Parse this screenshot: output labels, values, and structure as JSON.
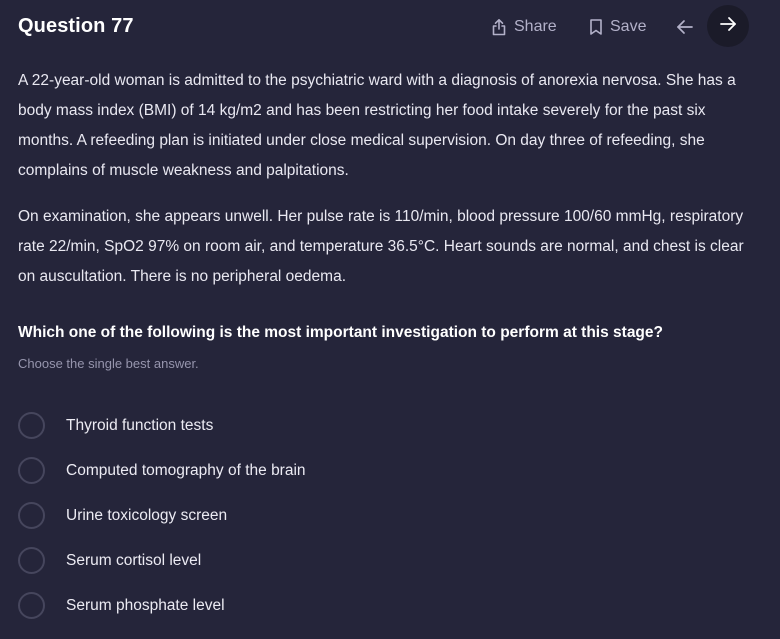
{
  "header": {
    "title": "Question 77",
    "share_label": "Share",
    "save_label": "Save"
  },
  "question": {
    "stem": [
      "A 22-year-old woman is admitted to the psychiatric ward with a diagnosis of anorexia nervosa. She has a body mass index (BMI) of 14 kg/m2 and has been restricting her food intake severely for the past six months. A refeeding plan is initiated under close medical supervision. On day three of refeeding, she complains of muscle weakness and palpitations.",
      "On examination, she appears unwell. Her pulse rate is 110/min, blood pressure 100/60 mmHg, respiratory rate 22/min, SpO2 97% on room air, and temperature 36.5°C. Heart sounds are normal, and chest is clear on auscultation. There is no peripheral oedema."
    ],
    "prompt": "Which one of the following is the most important investigation to perform at this stage?",
    "instruction": "Choose the single best answer."
  },
  "options": [
    {
      "label": "Thyroid function tests"
    },
    {
      "label": "Computed tomography of the brain"
    },
    {
      "label": "Urine toxicology screen"
    },
    {
      "label": "Serum cortisol level"
    },
    {
      "label": "Serum phosphate level"
    }
  ],
  "icons": {
    "share": "share-icon",
    "save": "bookmark-icon",
    "back": "arrow-left-icon",
    "next": "arrow-right-icon"
  },
  "colors": {
    "background": "#25253a",
    "muted_text": "#b3b1c9",
    "radio_border": "#46465d",
    "next_button_bg": "#1b1b29"
  }
}
